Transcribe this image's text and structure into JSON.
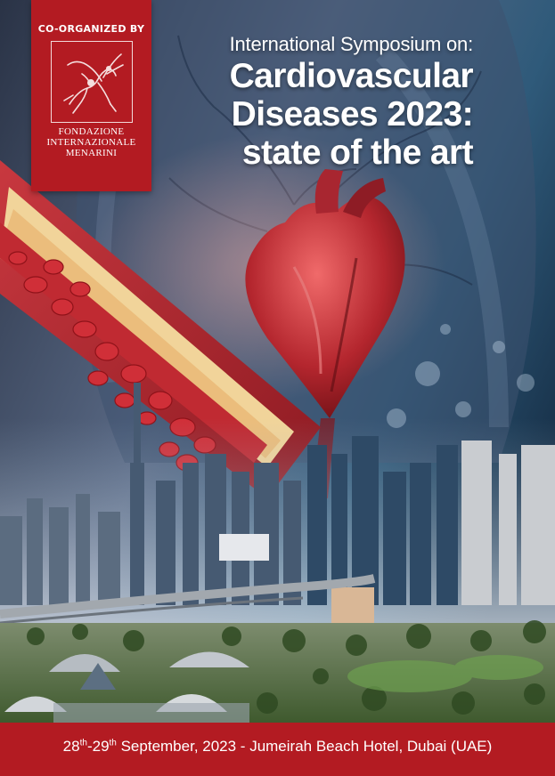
{
  "organizer": {
    "co_organized_label": "CO-ORGANIZED BY",
    "foundation_lines": [
      "FONDAZIONE",
      "INTERNAZIONALE",
      "MENARINI"
    ]
  },
  "title": {
    "subtitle": "International Symposium on:",
    "lines": [
      "Cardiovascular",
      "Diseases 2023:",
      "state of the art"
    ]
  },
  "footer": {
    "day_start": "28",
    "day_start_suffix": "th",
    "separator": "-",
    "day_end": "29",
    "day_end_suffix": "th",
    "rest": " September, 2023 - Jumeirah Beach Hotel, Dubai (UAE)"
  },
  "colors": {
    "brand_red": "#b31b22",
    "text_white": "#ffffff"
  }
}
